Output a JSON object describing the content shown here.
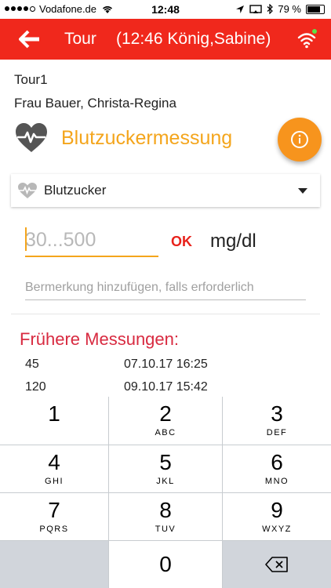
{
  "status_bar": {
    "carrier": "Vodafone.de",
    "time": "12:48",
    "battery": "79 %"
  },
  "app_bar": {
    "title": "Tour",
    "subtitle": "(12:46 König,Sabine)",
    "icons": [
      "arrow-left-icon",
      "wifi-icon"
    ]
  },
  "tour": {
    "name": "Tour1",
    "patient": "Frau Bauer, Christa-Regina"
  },
  "measurement": {
    "title": "Blutzuckermessung",
    "type_selected": "Blutzucker",
    "value_placeholder": "30...500",
    "ok_label": "OK",
    "unit": "mg/dl",
    "remark_placeholder": "Bermerkung hinzufügen, falls erforderlich"
  },
  "history": {
    "title": "Frühere Messungen:",
    "rows": [
      {
        "value": "45",
        "date": "07.10.17 16:25"
      },
      {
        "value": "120",
        "date": "09.10.17 15:42"
      }
    ]
  },
  "keypad": {
    "keys": [
      {
        "num": "1",
        "letters": ""
      },
      {
        "num": "2",
        "letters": "ABC"
      },
      {
        "num": "3",
        "letters": "DEF"
      },
      {
        "num": "4",
        "letters": "GHI"
      },
      {
        "num": "5",
        "letters": "JKL"
      },
      {
        "num": "6",
        "letters": "MNO"
      },
      {
        "num": "7",
        "letters": "PQRS"
      },
      {
        "num": "8",
        "letters": "TUV"
      },
      {
        "num": "9",
        "letters": "WXYZ"
      },
      {
        "num": "0",
        "letters": ""
      }
    ]
  },
  "colors": {
    "app_bar": "#f0281c",
    "accent_orange": "#f4a51c",
    "history_title": "#d82a40",
    "ok_red": "#e8221b"
  }
}
